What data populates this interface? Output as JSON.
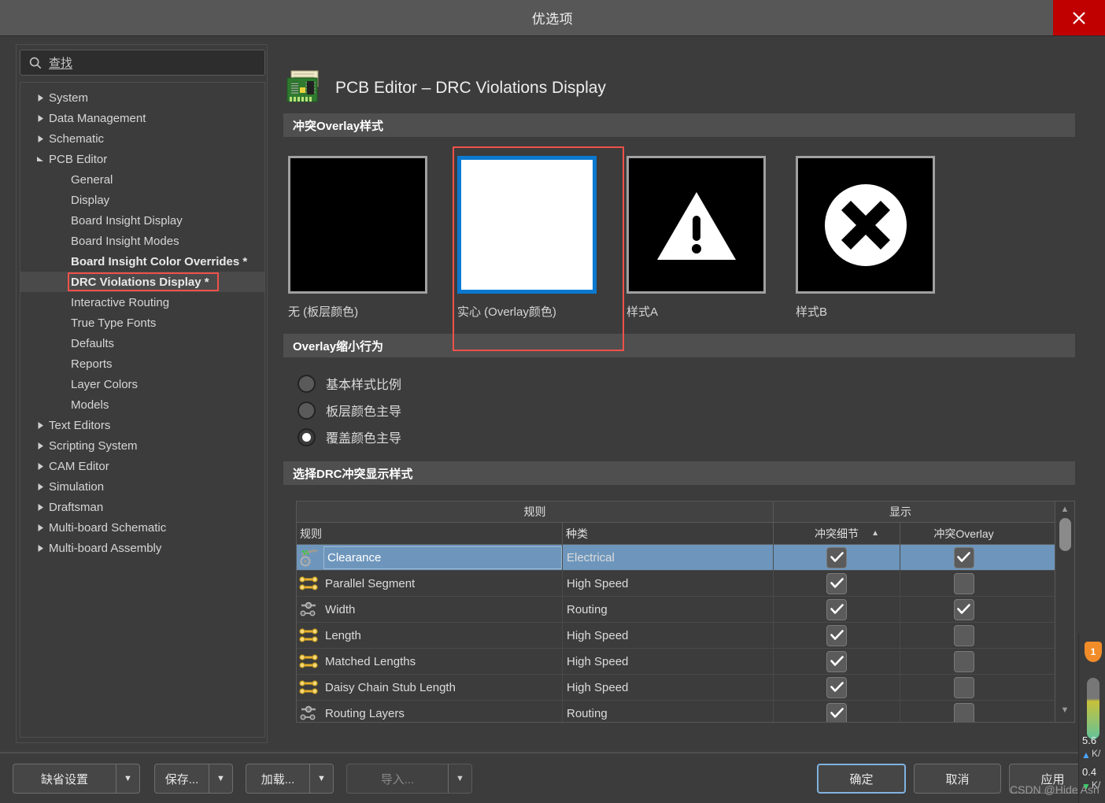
{
  "window": {
    "title": "优选项",
    "close_label": "close-icon"
  },
  "search": {
    "placeholder": "查找",
    "value": ""
  },
  "sidebar": {
    "items": [
      {
        "label": "System",
        "level": 0,
        "expandable": true,
        "expanded": false,
        "bold": false,
        "selected": false
      },
      {
        "label": "Data Management",
        "level": 0,
        "expandable": true,
        "expanded": false,
        "bold": false,
        "selected": false
      },
      {
        "label": "Schematic",
        "level": 0,
        "expandable": true,
        "expanded": false,
        "bold": false,
        "selected": false
      },
      {
        "label": "PCB Editor",
        "level": 0,
        "expandable": true,
        "expanded": true,
        "bold": false,
        "selected": false
      },
      {
        "label": "General",
        "level": 1,
        "expandable": false,
        "expanded": false,
        "bold": false,
        "selected": false
      },
      {
        "label": "Display",
        "level": 1,
        "expandable": false,
        "expanded": false,
        "bold": false,
        "selected": false
      },
      {
        "label": "Board Insight Display",
        "level": 1,
        "expandable": false,
        "expanded": false,
        "bold": false,
        "selected": false
      },
      {
        "label": "Board Insight Modes",
        "level": 1,
        "expandable": false,
        "expanded": false,
        "bold": false,
        "selected": false
      },
      {
        "label": "Board Insight Color Overrides *",
        "level": 1,
        "expandable": false,
        "expanded": false,
        "bold": true,
        "selected": false
      },
      {
        "label": "DRC Violations Display *",
        "level": 1,
        "expandable": false,
        "expanded": false,
        "bold": true,
        "selected": true
      },
      {
        "label": "Interactive Routing",
        "level": 1,
        "expandable": false,
        "expanded": false,
        "bold": false,
        "selected": false
      },
      {
        "label": "True Type Fonts",
        "level": 1,
        "expandable": false,
        "expanded": false,
        "bold": false,
        "selected": false
      },
      {
        "label": "Defaults",
        "level": 1,
        "expandable": false,
        "expanded": false,
        "bold": false,
        "selected": false
      },
      {
        "label": "Reports",
        "level": 1,
        "expandable": false,
        "expanded": false,
        "bold": false,
        "selected": false
      },
      {
        "label": "Layer Colors",
        "level": 1,
        "expandable": false,
        "expanded": false,
        "bold": false,
        "selected": false
      },
      {
        "label": "Models",
        "level": 1,
        "expandable": false,
        "expanded": false,
        "bold": false,
        "selected": false
      },
      {
        "label": "Text Editors",
        "level": 0,
        "expandable": true,
        "expanded": false,
        "bold": false,
        "selected": false
      },
      {
        "label": "Scripting System",
        "level": 0,
        "expandable": true,
        "expanded": false,
        "bold": false,
        "selected": false
      },
      {
        "label": "CAM Editor",
        "level": 0,
        "expandable": true,
        "expanded": false,
        "bold": false,
        "selected": false
      },
      {
        "label": "Simulation",
        "level": 0,
        "expandable": true,
        "expanded": false,
        "bold": false,
        "selected": false
      },
      {
        "label": "Draftsman",
        "level": 0,
        "expandable": true,
        "expanded": false,
        "bold": false,
        "selected": false
      },
      {
        "label": "Multi-board Schematic",
        "level": 0,
        "expandable": true,
        "expanded": false,
        "bold": false,
        "selected": false
      },
      {
        "label": "Multi-board Assembly",
        "level": 0,
        "expandable": true,
        "expanded": false,
        "bold": false,
        "selected": false
      }
    ]
  },
  "page": {
    "title": "PCB Editor – DRC Violations Display",
    "icon": "pcb-board-icon"
  },
  "overlay_style": {
    "section_title": "冲突Overlay样式",
    "options": [
      {
        "label": "无 (板层颜色)",
        "kind": "black",
        "selected": false
      },
      {
        "label": "实心 (Overlay颜色)",
        "kind": "solid",
        "selected": true
      },
      {
        "label": "样式A",
        "kind": "warning",
        "selected": false
      },
      {
        "label": "样式B",
        "kind": "cross",
        "selected": false
      }
    ]
  },
  "shrink_behavior": {
    "section_title": "Overlay缩小行为",
    "options": [
      {
        "label": "基本样式比例",
        "checked": false
      },
      {
        "label": "板层颜色主导",
        "checked": false
      },
      {
        "label": "覆盖颜色主导",
        "checked": true
      }
    ]
  },
  "drc_table": {
    "section_title": "选择DRC冲突显示样式",
    "group_headers": [
      "规则",
      "显示"
    ],
    "columns": [
      "规则",
      "种类",
      "冲突细节",
      "冲突Overlay"
    ],
    "sort_column": "冲突细节",
    "sort_direction": "asc",
    "rows": [
      {
        "rule": "Clearance",
        "kind": "Electrical",
        "detail": true,
        "overlay": true,
        "icon": "clearance-icon",
        "selected": true
      },
      {
        "rule": "Parallel Segment",
        "kind": "High Speed",
        "detail": true,
        "overlay": false,
        "icon": "high-speed-icon",
        "selected": false
      },
      {
        "rule": "Width",
        "kind": "Routing",
        "detail": true,
        "overlay": true,
        "icon": "routing-icon",
        "selected": false
      },
      {
        "rule": "Length",
        "kind": "High Speed",
        "detail": true,
        "overlay": false,
        "icon": "high-speed-icon",
        "selected": false
      },
      {
        "rule": "Matched Lengths",
        "kind": "High Speed",
        "detail": true,
        "overlay": false,
        "icon": "high-speed-icon",
        "selected": false
      },
      {
        "rule": "Daisy Chain Stub Length",
        "kind": "High Speed",
        "detail": true,
        "overlay": false,
        "icon": "high-speed-icon",
        "selected": false
      },
      {
        "rule": "Routing Layers",
        "kind": "Routing",
        "detail": true,
        "overlay": false,
        "icon": "routing-icon",
        "selected": false
      }
    ]
  },
  "footer": {
    "defaults_label": "缺省设置",
    "save_label": "保存...",
    "load_label": "加载...",
    "import_label": "导入...",
    "import_disabled": true,
    "ok_label": "确定",
    "cancel_label": "取消",
    "apply_label": "应用"
  },
  "edge_widget": {
    "badge": "1",
    "up_value": "5.6",
    "up_unit": "K/",
    "down_value": "0.4",
    "down_unit": "K/"
  },
  "watermark": "CSDN @Hide Asn",
  "colors": {
    "dialog_bg": "#3c3c3c",
    "titlebar_bg": "#575757",
    "close_red": "#c00000",
    "section_bar": "#4f4f4f",
    "accent_blue": "#0b79d0",
    "highlight_red": "#f0514a",
    "row_selected": "#6e96bc"
  }
}
